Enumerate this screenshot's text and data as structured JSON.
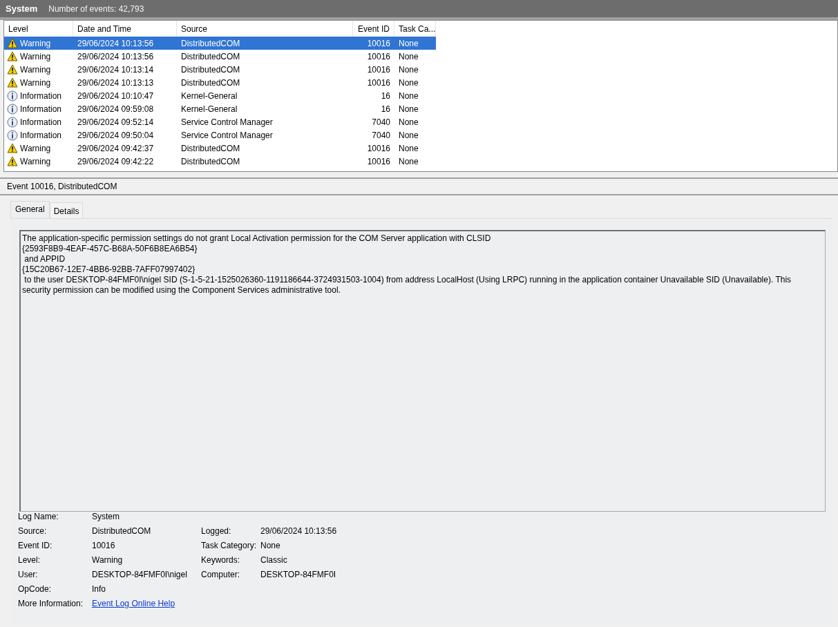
{
  "header": {
    "title": "System",
    "count": "Number of events: 42,793"
  },
  "table": {
    "columns": [
      {
        "label": "Level",
        "kind": "text"
      },
      {
        "label": "Date and Time",
        "kind": "text"
      },
      {
        "label": "Source",
        "kind": "text"
      },
      {
        "label": "Event ID",
        "kind": "number"
      },
      {
        "label": "Task Ca...",
        "kind": "text"
      }
    ],
    "rows": [
      {
        "kind": "warning",
        "selected": true,
        "cells": [
          "Warning",
          "29/06/2024 10:13:56",
          "DistributedCOM",
          "10016",
          "None"
        ]
      },
      {
        "kind": "warning",
        "selected": false,
        "cells": [
          "Warning",
          "29/06/2024 10:13:56",
          "DistributedCOM",
          "10016",
          "None"
        ]
      },
      {
        "kind": "warning",
        "selected": false,
        "cells": [
          "Warning",
          "29/06/2024 10:13:14",
          "DistributedCOM",
          "10016",
          "None"
        ]
      },
      {
        "kind": "warning",
        "selected": false,
        "cells": [
          "Warning",
          "29/06/2024 10:13:13",
          "DistributedCOM",
          "10016",
          "None"
        ]
      },
      {
        "kind": "information",
        "selected": false,
        "cells": [
          "Information",
          "29/06/2024 10:10:47",
          "Kernel-General",
          "16",
          "None"
        ]
      },
      {
        "kind": "information",
        "selected": false,
        "cells": [
          "Information",
          "29/06/2024 09:59:08",
          "Kernel-General",
          "16",
          "None"
        ]
      },
      {
        "kind": "information",
        "selected": false,
        "cells": [
          "Information",
          "29/06/2024 09:52:14",
          "Service Control Manager",
          "7040",
          "None"
        ]
      },
      {
        "kind": "information",
        "selected": false,
        "cells": [
          "Information",
          "29/06/2024 09:50:04",
          "Service Control Manager",
          "7040",
          "None"
        ]
      },
      {
        "kind": "warning",
        "selected": false,
        "cells": [
          "Warning",
          "29/06/2024 09:42:37",
          "DistributedCOM",
          "10016",
          "None"
        ]
      },
      {
        "kind": "warning",
        "selected": false,
        "cells": [
          "Warning",
          "29/06/2024 09:42:22",
          "DistributedCOM",
          "10016",
          "None"
        ]
      }
    ]
  },
  "detail": {
    "title": "Event 10016, DistributedCOM",
    "tabs": [
      {
        "label": "General",
        "selected": true
      },
      {
        "label": "Details",
        "selected": false
      }
    ],
    "description": "The application-specific permission settings do not grant Local Activation permission for the COM Server application with CLSID\n{2593F8B9-4EAF-457C-B68A-50F6B8EA6B54}\n and APPID\n{15C20B67-12E7-4BB6-92BB-7AFF07997402}\n to the user DESKTOP-84FMF0I\\nigel SID (S-1-5-21-1525026360-1191186644-3724931503-1004) from address LocalHost (Using LRPC) running in the application container Unavailable SID (Unavailable). This security permission can be modified using the Component Services administrative tool.",
    "fields": [
      {
        "cells": [
          {
            "label": "Log Name:",
            "value": "System",
            "kind": "text"
          }
        ]
      },
      {
        "cells": [
          {
            "label": "Source:",
            "value": "DistributedCOM",
            "kind": "text"
          },
          {
            "label": "Logged:",
            "value": "29/06/2024 10:13:56",
            "kind": "text"
          }
        ]
      },
      {
        "cells": [
          {
            "label": "Event ID:",
            "value": "10016",
            "kind": "text"
          },
          {
            "label": "Task Category:",
            "value": "None",
            "kind": "text"
          }
        ]
      },
      {
        "cells": [
          {
            "label": "Level:",
            "value": "Warning",
            "kind": "text"
          },
          {
            "label": "Keywords:",
            "value": "Classic",
            "kind": "text"
          }
        ]
      },
      {
        "cells": [
          {
            "label": "User:",
            "value": "DESKTOP-84FMF0I\\nigel",
            "kind": "text"
          },
          {
            "label": "Computer:",
            "value": "DESKTOP-84FMF0I",
            "kind": "text"
          }
        ]
      },
      {
        "cells": [
          {
            "label": "OpCode:",
            "value": "Info",
            "kind": "text"
          }
        ]
      },
      {
        "cells": [
          {
            "label": "More Information:",
            "value": "Event Log Online Help",
            "kind": "link"
          }
        ]
      }
    ]
  }
}
